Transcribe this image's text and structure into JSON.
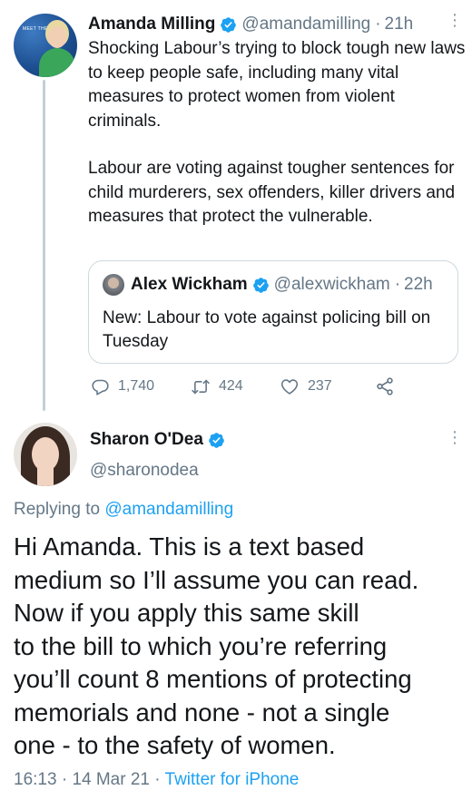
{
  "tweet1": {
    "author_name": "Amanda Milling",
    "handle": "@amandamilling",
    "time": "21h",
    "text_paragraphs": [
      "Shocking Labour’s trying to block tough new laws to keep people safe, including many vital measures to protect women from violent criminals.",
      "Labour are voting against tougher sentences for child murderers, sex offenders, killer drivers and measures that protect the vulnerable."
    ],
    "avatar_caption": "MEET THE",
    "quoted": {
      "author_name": "Alex Wickham",
      "handle": "@alexwickham",
      "time": "22h",
      "text": "New: Labour to vote against policing bill on Tuesday"
    },
    "actions": {
      "replies": "1,740",
      "retweets": "424",
      "likes": "237"
    }
  },
  "tweet2": {
    "author_name": "Sharon O'Dea",
    "handle": "@sharonodea",
    "replying_prefix": "Replying to",
    "replying_to": "@amandamilling",
    "text_lines": [
      "Hi Amanda. This is a text based",
      "medium so I’ll assume you can read.",
      "Now if you apply this same skill",
      "to the bill to which you’re referring",
      "you’ll count 8 mentions of protecting",
      "memorials and none - not a single",
      "one - to the safety of women."
    ],
    "time": "16:13",
    "date": "14 Mar 21",
    "source": "Twitter for iPhone"
  },
  "colors": {
    "verified_blue": "#1da1f2",
    "secondary_text": "#657786",
    "link_blue": "#1da1f2"
  }
}
